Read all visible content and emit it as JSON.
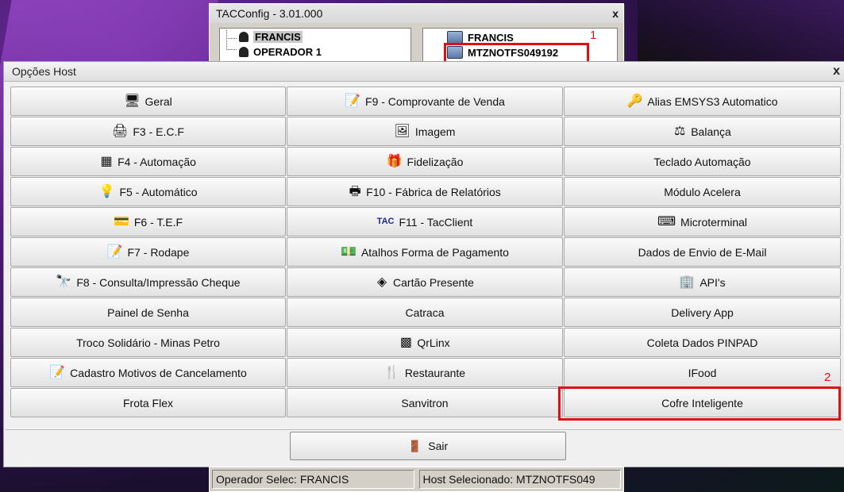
{
  "back_window": {
    "title": "TACConfig  - 3.01.000",
    "close": "x",
    "left_tree": [
      {
        "label": "FRANCIS",
        "icon": "user-icon",
        "selected": true
      },
      {
        "label": "OPERADOR 1",
        "icon": "user-icon",
        "selected": false
      }
    ],
    "right_tree": [
      {
        "label": "FRANCIS",
        "icon": "host-icon"
      },
      {
        "label": "MTZNOTFS049192",
        "icon": "host-icon"
      }
    ],
    "annotation_1": "1"
  },
  "main_window": {
    "title": "Opções Host",
    "close": "x",
    "annotation_2": "2",
    "buttons": [
      {
        "label": "Geral",
        "icon": "computer-icon",
        "glyph": "🖥"
      },
      {
        "label": "F9 - Comprovante de Venda",
        "icon": "notepad-icon",
        "glyph": "📝"
      },
      {
        "label": "Alias EMSYS3 Automatico",
        "icon": "key-icon",
        "glyph": "🔑"
      },
      {
        "label": "F3 - E.C.F",
        "icon": "printer-icon",
        "glyph": "🖨"
      },
      {
        "label": "Imagem",
        "icon": "image-icon",
        "glyph": "🖼"
      },
      {
        "label": "Balança",
        "icon": "scale-icon",
        "glyph": "⚖"
      },
      {
        "label": "F4 - Automação",
        "icon": "chip-icon",
        "glyph": "▦"
      },
      {
        "label": "Fidelização",
        "icon": "gift-icon",
        "glyph": "🎁"
      },
      {
        "label": "Teclado Automação",
        "icon": "",
        "glyph": ""
      },
      {
        "label": "F5 - Automático",
        "icon": "lightbulb-icon",
        "glyph": "💡"
      },
      {
        "label": "F10 - Fábrica de Relatórios",
        "icon": "printer-icon",
        "glyph": "🖶"
      },
      {
        "label": "Módulo Acelera",
        "icon": "",
        "glyph": ""
      },
      {
        "label": "F6 - T.E.F",
        "icon": "card-icon",
        "glyph": "💳"
      },
      {
        "label": "F11 - TacClient",
        "icon": "tacclient-icon",
        "glyph": "TAC"
      },
      {
        "label": "Microterminal",
        "icon": "keyboard-icon",
        "glyph": "⌨"
      },
      {
        "label": "F7 - Rodape",
        "icon": "notepad-icon",
        "glyph": "📝"
      },
      {
        "label": "Atalhos Forma de Pagamento",
        "icon": "money-icon",
        "glyph": "💵"
      },
      {
        "label": "Dados de Envio de E-Mail",
        "icon": "",
        "glyph": ""
      },
      {
        "label": "F8 - Consulta/Impressão Cheque",
        "icon": "binoculars-icon",
        "glyph": "🔭"
      },
      {
        "label": "Cartão Presente",
        "icon": "gift-card-icon",
        "glyph": "◈"
      },
      {
        "label": "API's",
        "icon": "building-icon",
        "glyph": "🏢"
      },
      {
        "label": "Painel de Senha",
        "icon": "",
        "glyph": ""
      },
      {
        "label": "Catraca",
        "icon": "",
        "glyph": ""
      },
      {
        "label": "Delivery App",
        "icon": "",
        "glyph": ""
      },
      {
        "label": "Troco Solidário - Minas Petro",
        "icon": "",
        "glyph": ""
      },
      {
        "label": "QrLinx",
        "icon": "qrcode-icon",
        "glyph": "▩"
      },
      {
        "label": "Coleta Dados PINPAD",
        "icon": "",
        "glyph": ""
      },
      {
        "label": "Cadastro Motivos de Cancelamento",
        "icon": "notepad-icon",
        "glyph": "📝"
      },
      {
        "label": "Restaurante",
        "icon": "cutlery-icon",
        "glyph": "🍴"
      },
      {
        "label": "IFood",
        "icon": "",
        "glyph": ""
      },
      {
        "label": "Frota Flex",
        "icon": "",
        "glyph": ""
      },
      {
        "label": "Sanvitron",
        "icon": "",
        "glyph": ""
      },
      {
        "label": "Cofre Inteligente",
        "icon": "",
        "glyph": ""
      }
    ],
    "exit": {
      "label": "Sair",
      "icon": "exit-door-icon",
      "glyph": "🚪"
    }
  },
  "status_bar": {
    "operator": "Operador Selec: FRANCIS",
    "host": "Host Selecionado: MTZNOTFS049"
  },
  "colors": {
    "annotation": "#e01010"
  }
}
